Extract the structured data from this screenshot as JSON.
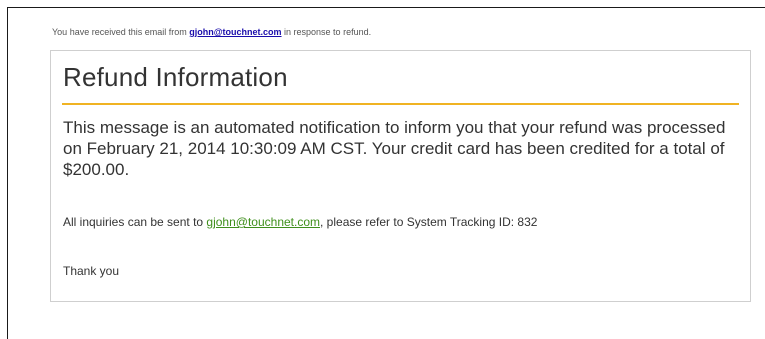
{
  "notice": {
    "prefix": "You have received this email from ",
    "sender_email": "gjohn@touchnet.com",
    "suffix": " in response to refund."
  },
  "card": {
    "title": "Refund Information",
    "message": "This message is an automated notification to inform you that your refund was processed on February 21, 2014 10:30:09 AM CST. Your credit card has been credited for a total of $200.00.",
    "inquiry_prefix": "All inquiries can be sent to ",
    "inquiry_email": "gjohn@touchnet.com",
    "inquiry_suffix": ", please refer to System Tracking ID: 832",
    "thanks": "Thank you"
  },
  "colors": {
    "accent_rule": "#f0b323",
    "notice_link": "#1a0dab",
    "inquiry_link": "#3f8f1c"
  }
}
